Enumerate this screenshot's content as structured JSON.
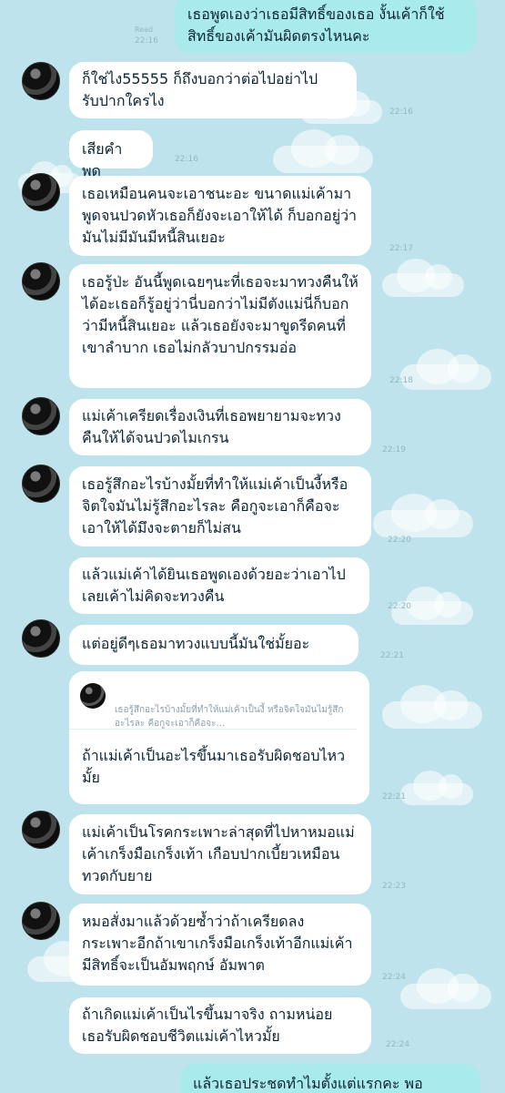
{
  "conversation": {
    "messages": [
      {
        "side": "out",
        "text": "เธอพูดเองว่าเธอมีสิทธิ์ของเธอ งั้นเค้าก็ใช้สิทธิ์ของเค้ามันผิดตรงไหนคะ",
        "time": "22:16",
        "read": "Read"
      },
      {
        "side": "in",
        "text": "ก็ใช่ไง55555 ก็ถึงบอกว่าต่อไปอย่าไปรับปากใครไง",
        "time": "22:16"
      },
      {
        "side": "in",
        "text": "เสียคำพูด",
        "time": "22:16"
      },
      {
        "side": "in",
        "text": "เธอเหมือนคนจะเอาชนะอะ ขนาดแม่เค้ามาพูดจนปวดหัวเธอก็ยังจะเอาให้ได้ ก็บอกอยู่ว่ามันไม่มีมันมีหนี้สินเยอะ",
        "time": "22:17"
      },
      {
        "side": "in",
        "text": "เธอรู้ป่ะ อันนี้พูดเฉยๆนะที่เธอจะมาทวงคืนให้ได้อะเธอก็รู้อยู่ว่านี่บอกว่าไม่มีตังแม่นี่ก็บอกว่ามีหนี้สินเยอะ แล้วเธอยังจะมาขูดรีดคนที่เขาลำบาก เธอไม่กลัวบาปกรรมอ่อ",
        "time": "22:18"
      },
      {
        "side": "in",
        "text": "แม่เค้าเครียดเรื่องเงินที่เธอพยายามจะทวงคืนให้ได้จนปวดไมเกรน",
        "time": "22:19"
      },
      {
        "side": "in",
        "text": "เธอรู้สึกอะไรบ้างมั้ยที่ทำให้แม่เค้าเป็นงี้หรือจิตใจมันไม่รู้สึกอะไรละ คือกูจะเอาก็คือจะเอาให้ได้มึงจะตายก็ไม่สน",
        "time": "22:20"
      },
      {
        "side": "in",
        "text": "แล้วแม่เค้าได้ยินเธอพูดเองด้วยอะว่าเอาไปเลยเค้าไม่คิดจะทวงคืน",
        "time": "22:20"
      },
      {
        "side": "in",
        "text": "แต่อยู่ดีๆเธอมาทวงแบบนี้มันใช่มั้ยอะ",
        "time": "22:21"
      },
      {
        "side": "in",
        "quote": "เธอรู้สึกอะไรบ้างมั้ยที่ทำให้แม่เค้าเป็นงี้ หรือจิตใจมันไม่รู้สึกอะไรละ คือกูจะเอาก็คือจะ...",
        "text": "ถ้าแม่เค้าเป็นอะไรขึ้นมาเธอรับผิดชอบไหวมั้ย",
        "time": "22:21"
      },
      {
        "side": "in",
        "text": "แม่เค้าเป็นโรคกระเพาะล่าสุดที่ไปหาหมอแม่เค้าเกร็งมือเกร็งเท้า เกือบปากเบี้ยวเหมือนทวดกับยาย",
        "time": "22:23"
      },
      {
        "side": "in",
        "text": "หมอสั่งมาแล้วด้วยซ้ำว่าถ้าเครียดลงกระเพาะอีกถ้าเขาเกร็งมือเกร็งเท้าอีกแม่เค้ามีสิทธิ์จะเป็นอัมพฤกษ์ อัมพาต",
        "time": "22:24"
      },
      {
        "side": "in",
        "text": "ถ้าเกิดแม่เค้าเป็นไรขึ้นมาจริง ถามหน่อย เธอรับผิดชอบชีวิตแม่เค้าไหวมั้ย",
        "time": "22:24"
      },
      {
        "side": "out",
        "text": "แล้วเธอประชดทำไมตั้งแต่แรกคะ พอ",
        "time": ""
      }
    ]
  }
}
